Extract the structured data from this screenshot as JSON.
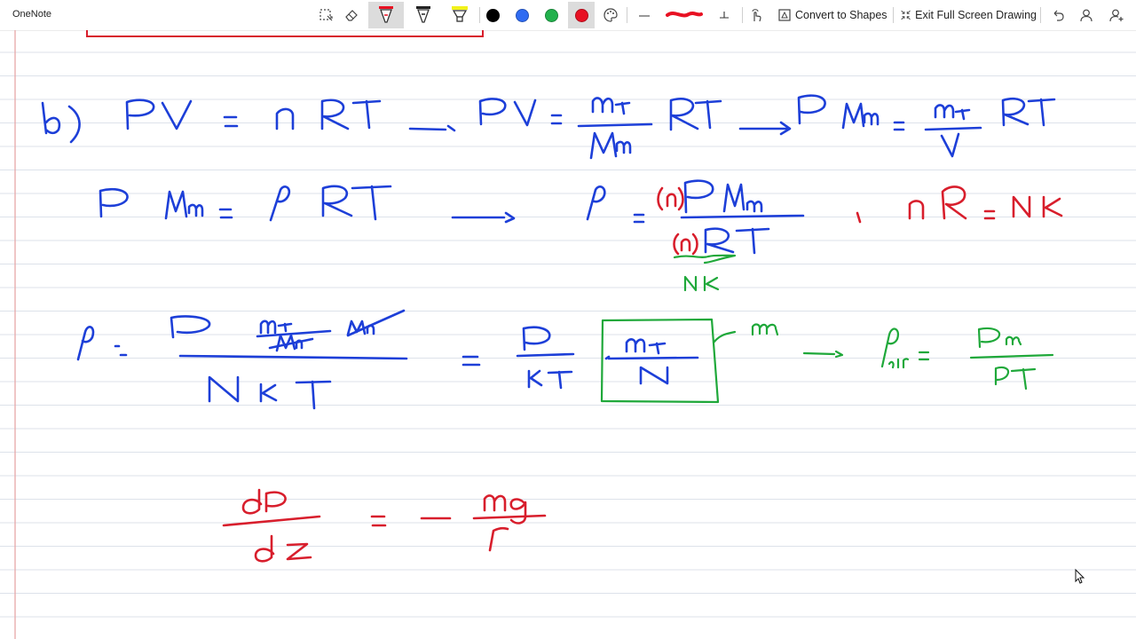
{
  "app": {
    "title": "OneNote"
  },
  "toolbar": {
    "lasso_icon": "lasso-select-icon",
    "eraser_icon": "eraser-icon",
    "pens": [
      {
        "name": "red-pen",
        "color": "#e81123",
        "selected": true
      },
      {
        "name": "black-pen",
        "color": "#222222",
        "selected": false
      },
      {
        "name": "highlighter",
        "color": "#f2f21a",
        "selected": false
      }
    ],
    "colors": [
      {
        "name": "black",
        "hex": "#000000"
      },
      {
        "name": "blue",
        "hex": "#2f6bf2"
      },
      {
        "name": "green",
        "hex": "#22b14c"
      },
      {
        "name": "red",
        "hex": "#e81123",
        "selected": true
      }
    ],
    "more_colors_icon": "palette-icon",
    "thin_stroke_icon": "thin-stroke-icon",
    "thick_stroke_icon": "thick-stroke-icon",
    "add_thickness_icon": "plus-icon",
    "touch_draw_icon": "touch-drawing-icon",
    "convert_to_shapes_label": "Convert to Shapes",
    "exit_full_screen_label": "Exit Full Screen Drawing",
    "undo_icon": "undo-icon",
    "account_icon": "person-icon",
    "share_icon": "add-person-icon"
  },
  "colors": {
    "ink_blue": "#1d3fd8",
    "ink_red": "#d81e2c",
    "ink_green": "#1fa83a",
    "rule_line": "#dde2ea",
    "margin_line": "#e6a8a8"
  }
}
